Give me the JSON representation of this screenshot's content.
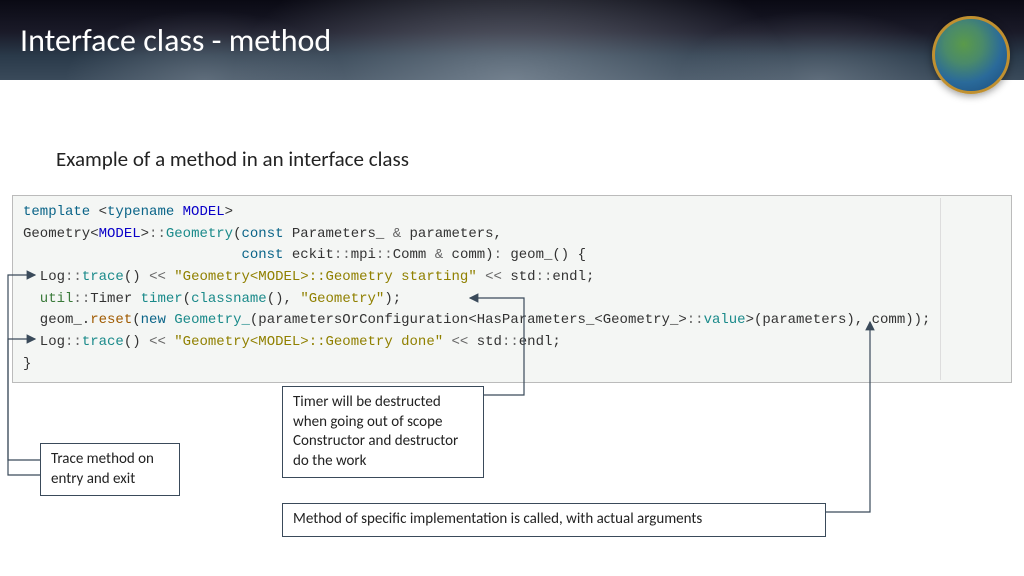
{
  "banner": {
    "title": "Interface class - method"
  },
  "subtitle": "Example of a method in an interface class",
  "code": {
    "l1a": "template",
    "l1b": " <",
    "l1c": "typename",
    "l1d": " ",
    "l1e": "MODEL",
    "l1f": ">",
    "l2a": "Geometry",
    "l2b": "<",
    "l2c": "MODEL",
    "l2d": ">",
    "l2e": "::",
    "l2f": "Geometry",
    "l2g": "(",
    "l2h": "const",
    "l2i": " Parameters_ ",
    "l2j": "&",
    "l2k": " parameters,",
    "l3a": "                          ",
    "l3b": "const",
    "l3c": " eckit",
    "l3d": "::",
    "l3e": "mpi",
    "l3f": "::",
    "l3g": "Comm ",
    "l3h": "&",
    "l3i": " comm)",
    "l3j": ":",
    "l3k": " geom_() {",
    "l4a": "  Log",
    "l4b": "::",
    "l4c": "trace",
    "l4d": "() ",
    "l4e": "<<",
    "l4f": " ",
    "l4g": "\"Geometry<MODEL>::Geometry starting\"",
    "l4h": " ",
    "l4i": "<<",
    "l4j": " std",
    "l4k": "::",
    "l4l": "endl;",
    "l5a": "  util",
    "l5b": "::",
    "l5c": "Timer ",
    "l5d": "timer",
    "l5e": "(",
    "l5f": "classname",
    "l5g": "(), ",
    "l5h": "\"Geometry\"",
    "l5i": ");",
    "l6a": "  geom_.",
    "l6b": "reset",
    "l6c": "(",
    "l6d": "new",
    "l6e": " ",
    "l6f": "Geometry_",
    "l6g": "(parametersOrConfiguration<HasParameters_<Geometry_>",
    "l6h": "::",
    "l6i": "value",
    "l6j": ">(parameters), comm));",
    "l7a": "  Log",
    "l7b": "::",
    "l7c": "trace",
    "l7d": "() ",
    "l7e": "<<",
    "l7f": " ",
    "l7g": "\"Geometry<MODEL>::Geometry done\"",
    "l7h": " ",
    "l7i": "<<",
    "l7j": " std",
    "l7k": "::",
    "l7l": "endl;",
    "l8": "}"
  },
  "callouts": {
    "trace": "Trace method on entry and exit",
    "timer": "Timer will be destructed when going out of scope Constructor and destructor do the work",
    "method": "Method of specific implementation is called, with actual arguments"
  }
}
